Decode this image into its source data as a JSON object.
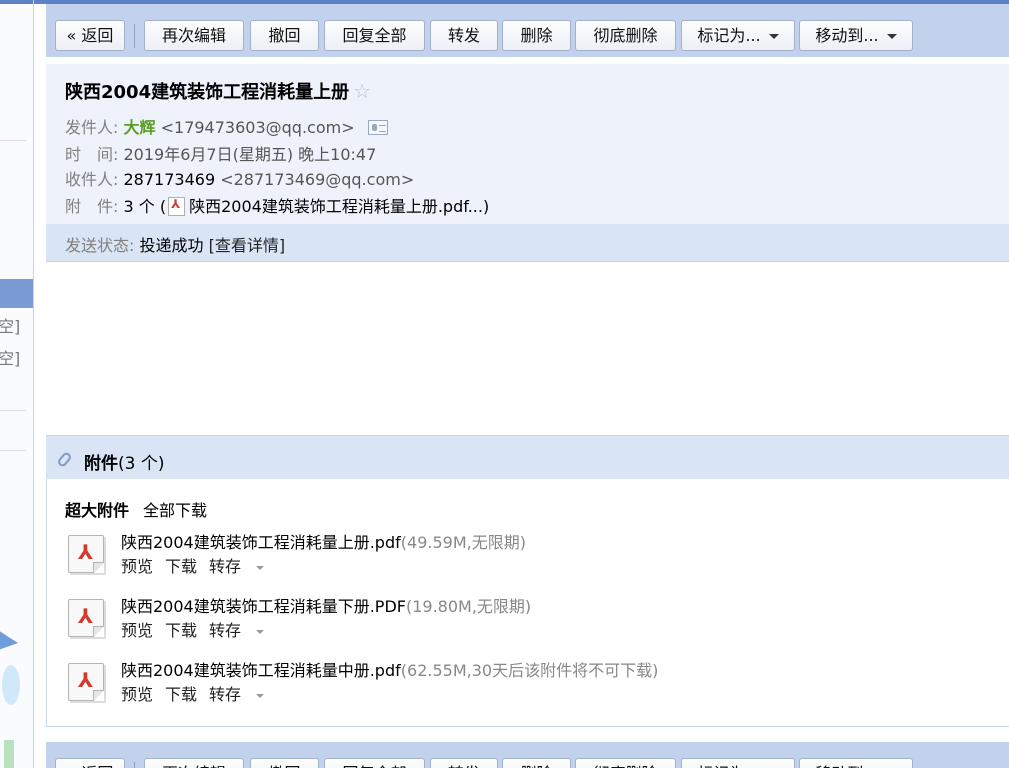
{
  "toolbar": {
    "back": "« 返回",
    "reedit": "再次编辑",
    "recall": "撤回",
    "reply_all": "回复全部",
    "forward": "转发",
    "delete": "删除",
    "perm_delete": "彻底删除",
    "mark_as": "标记为...",
    "move_to": "移动到..."
  },
  "email": {
    "subject": "陕西2004建筑装饰工程消耗量上册",
    "star_glyph": "☆",
    "from_label": "发件人:",
    "from_name": "大辉",
    "from_addr": "<179473603@qq.com>",
    "time_label": "时　间:",
    "time_value": "2019年6月7日(星期五) 晚上10:47",
    "to_label": "收件人:",
    "to_name": "287173469",
    "to_addr": "<287173469@qq.com>",
    "att_label": "附　件:",
    "att_count": "3 个 (",
    "att_preview": "陕西2004建筑装饰工程消耗量上册.pdf...)",
    "status_label": "发送状态:",
    "status_value": "投递成功",
    "status_link": "[查看详情]"
  },
  "attachments": {
    "title": "附件",
    "count": "(3 个)",
    "category": "超大附件",
    "download_all": "全部下载",
    "files": [
      {
        "name": "陕西2004建筑装饰工程消耗量上册.pdf",
        "meta": "(49.59M,无限期)"
      },
      {
        "name": "陕西2004建筑装饰工程消耗量下册.PDF",
        "meta": "(19.80M,无限期)"
      },
      {
        "name": "陕西2004建筑装饰工程消耗量中册.pdf",
        "meta": "(62.55M,30天后该附件将不可下载)"
      }
    ],
    "preview": "预览",
    "download": "下载",
    "save_to": "转存"
  },
  "sidebar": {
    "empty_1": "空]",
    "empty_2": "空]"
  },
  "colors": {
    "accent": "#5c81c4",
    "toolbar_bg": "#c2d2ec",
    "header_bg": "#eef3fb",
    "sender_name": "#5b9e25"
  }
}
